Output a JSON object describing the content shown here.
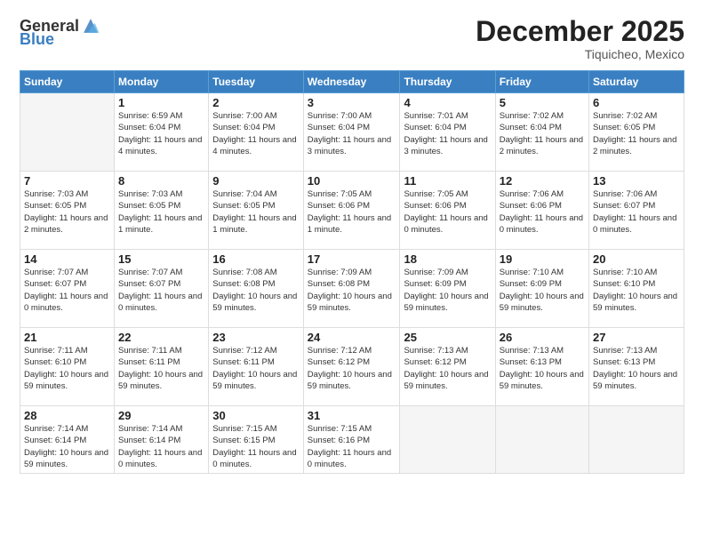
{
  "header": {
    "logo_general": "General",
    "logo_blue": "Blue",
    "month_year": "December 2025",
    "location": "Tiquicheo, Mexico"
  },
  "days_of_week": [
    "Sunday",
    "Monday",
    "Tuesday",
    "Wednesday",
    "Thursday",
    "Friday",
    "Saturday"
  ],
  "weeks": [
    [
      {
        "day": "",
        "empty": true
      },
      {
        "day": "1",
        "sunrise": "Sunrise: 6:59 AM",
        "sunset": "Sunset: 6:04 PM",
        "daylight": "Daylight: 11 hours and 4 minutes."
      },
      {
        "day": "2",
        "sunrise": "Sunrise: 7:00 AM",
        "sunset": "Sunset: 6:04 PM",
        "daylight": "Daylight: 11 hours and 4 minutes."
      },
      {
        "day": "3",
        "sunrise": "Sunrise: 7:00 AM",
        "sunset": "Sunset: 6:04 PM",
        "daylight": "Daylight: 11 hours and 3 minutes."
      },
      {
        "day": "4",
        "sunrise": "Sunrise: 7:01 AM",
        "sunset": "Sunset: 6:04 PM",
        "daylight": "Daylight: 11 hours and 3 minutes."
      },
      {
        "day": "5",
        "sunrise": "Sunrise: 7:02 AM",
        "sunset": "Sunset: 6:04 PM",
        "daylight": "Daylight: 11 hours and 2 minutes."
      },
      {
        "day": "6",
        "sunrise": "Sunrise: 7:02 AM",
        "sunset": "Sunset: 6:05 PM",
        "daylight": "Daylight: 11 hours and 2 minutes."
      }
    ],
    [
      {
        "day": "7",
        "sunrise": "Sunrise: 7:03 AM",
        "sunset": "Sunset: 6:05 PM",
        "daylight": "Daylight: 11 hours and 2 minutes."
      },
      {
        "day": "8",
        "sunrise": "Sunrise: 7:03 AM",
        "sunset": "Sunset: 6:05 PM",
        "daylight": "Daylight: 11 hours and 1 minute."
      },
      {
        "day": "9",
        "sunrise": "Sunrise: 7:04 AM",
        "sunset": "Sunset: 6:05 PM",
        "daylight": "Daylight: 11 hours and 1 minute."
      },
      {
        "day": "10",
        "sunrise": "Sunrise: 7:05 AM",
        "sunset": "Sunset: 6:06 PM",
        "daylight": "Daylight: 11 hours and 1 minute."
      },
      {
        "day": "11",
        "sunrise": "Sunrise: 7:05 AM",
        "sunset": "Sunset: 6:06 PM",
        "daylight": "Daylight: 11 hours and 0 minutes."
      },
      {
        "day": "12",
        "sunrise": "Sunrise: 7:06 AM",
        "sunset": "Sunset: 6:06 PM",
        "daylight": "Daylight: 11 hours and 0 minutes."
      },
      {
        "day": "13",
        "sunrise": "Sunrise: 7:06 AM",
        "sunset": "Sunset: 6:07 PM",
        "daylight": "Daylight: 11 hours and 0 minutes."
      }
    ],
    [
      {
        "day": "14",
        "sunrise": "Sunrise: 7:07 AM",
        "sunset": "Sunset: 6:07 PM",
        "daylight": "Daylight: 11 hours and 0 minutes."
      },
      {
        "day": "15",
        "sunrise": "Sunrise: 7:07 AM",
        "sunset": "Sunset: 6:07 PM",
        "daylight": "Daylight: 11 hours and 0 minutes."
      },
      {
        "day": "16",
        "sunrise": "Sunrise: 7:08 AM",
        "sunset": "Sunset: 6:08 PM",
        "daylight": "Daylight: 10 hours and 59 minutes."
      },
      {
        "day": "17",
        "sunrise": "Sunrise: 7:09 AM",
        "sunset": "Sunset: 6:08 PM",
        "daylight": "Daylight: 10 hours and 59 minutes."
      },
      {
        "day": "18",
        "sunrise": "Sunrise: 7:09 AM",
        "sunset": "Sunset: 6:09 PM",
        "daylight": "Daylight: 10 hours and 59 minutes."
      },
      {
        "day": "19",
        "sunrise": "Sunrise: 7:10 AM",
        "sunset": "Sunset: 6:09 PM",
        "daylight": "Daylight: 10 hours and 59 minutes."
      },
      {
        "day": "20",
        "sunrise": "Sunrise: 7:10 AM",
        "sunset": "Sunset: 6:10 PM",
        "daylight": "Daylight: 10 hours and 59 minutes."
      }
    ],
    [
      {
        "day": "21",
        "sunrise": "Sunrise: 7:11 AM",
        "sunset": "Sunset: 6:10 PM",
        "daylight": "Daylight: 10 hours and 59 minutes."
      },
      {
        "day": "22",
        "sunrise": "Sunrise: 7:11 AM",
        "sunset": "Sunset: 6:11 PM",
        "daylight": "Daylight: 10 hours and 59 minutes."
      },
      {
        "day": "23",
        "sunrise": "Sunrise: 7:12 AM",
        "sunset": "Sunset: 6:11 PM",
        "daylight": "Daylight: 10 hours and 59 minutes."
      },
      {
        "day": "24",
        "sunrise": "Sunrise: 7:12 AM",
        "sunset": "Sunset: 6:12 PM",
        "daylight": "Daylight: 10 hours and 59 minutes."
      },
      {
        "day": "25",
        "sunrise": "Sunrise: 7:13 AM",
        "sunset": "Sunset: 6:12 PM",
        "daylight": "Daylight: 10 hours and 59 minutes."
      },
      {
        "day": "26",
        "sunrise": "Sunrise: 7:13 AM",
        "sunset": "Sunset: 6:13 PM",
        "daylight": "Daylight: 10 hours and 59 minutes."
      },
      {
        "day": "27",
        "sunrise": "Sunrise: 7:13 AM",
        "sunset": "Sunset: 6:13 PM",
        "daylight": "Daylight: 10 hours and 59 minutes."
      }
    ],
    [
      {
        "day": "28",
        "sunrise": "Sunrise: 7:14 AM",
        "sunset": "Sunset: 6:14 PM",
        "daylight": "Daylight: 10 hours and 59 minutes."
      },
      {
        "day": "29",
        "sunrise": "Sunrise: 7:14 AM",
        "sunset": "Sunset: 6:14 PM",
        "daylight": "Daylight: 11 hours and 0 minutes."
      },
      {
        "day": "30",
        "sunrise": "Sunrise: 7:15 AM",
        "sunset": "Sunset: 6:15 PM",
        "daylight": "Daylight: 11 hours and 0 minutes."
      },
      {
        "day": "31",
        "sunrise": "Sunrise: 7:15 AM",
        "sunset": "Sunset: 6:16 PM",
        "daylight": "Daylight: 11 hours and 0 minutes."
      },
      {
        "day": "",
        "empty": true
      },
      {
        "day": "",
        "empty": true
      },
      {
        "day": "",
        "empty": true
      }
    ]
  ]
}
